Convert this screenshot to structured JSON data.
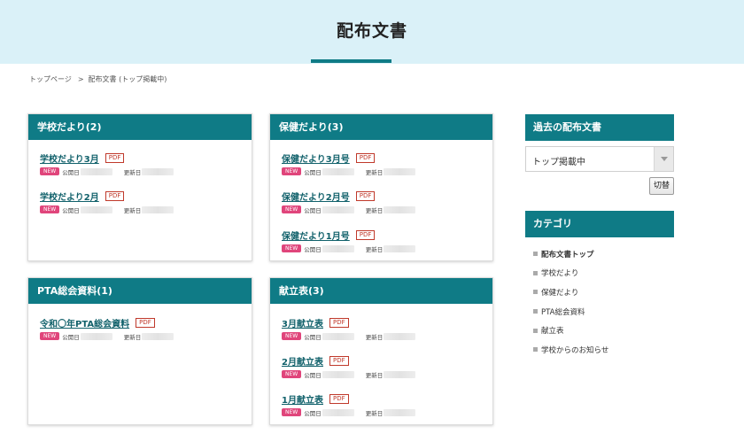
{
  "header": {
    "title": "配布文書"
  },
  "breadcrumb": {
    "home": "トップページ",
    "separator": ">",
    "current": "配布文書 (トップ掲載中)"
  },
  "labels": {
    "pdf": "PDF",
    "new": "NEW",
    "published": "公開日",
    "updated": "更新日"
  },
  "cards": {
    "school": {
      "title": "学校だより(2)",
      "items": [
        {
          "label": "学校だより3月"
        },
        {
          "label": "学校だより2月"
        }
      ]
    },
    "health": {
      "title": "保健だより(3)",
      "items": [
        {
          "label": "保健だより3月号"
        },
        {
          "label": "保健だより2月号"
        },
        {
          "label": "保健だより1月号"
        }
      ]
    },
    "pta": {
      "title": "PTA総会資料(1)",
      "items": [
        {
          "label": "令和〇年PTA総会資料"
        }
      ]
    },
    "menu": {
      "title": "献立表(3)",
      "items": [
        {
          "label": "3月献立表"
        },
        {
          "label": "2月献立表"
        },
        {
          "label": "1月献立表"
        }
      ]
    }
  },
  "sidebar": {
    "past_title": "過去の配布文書",
    "select_value": "トップ掲載中",
    "switch_label": "切替",
    "category_title": "カテゴリ",
    "categories": [
      {
        "label": "配布文書トップ"
      },
      {
        "label": "学校だより"
      },
      {
        "label": "保健だより"
      },
      {
        "label": "PTA総会資料"
      },
      {
        "label": "献立表"
      },
      {
        "label": "学校からのお知らせ"
      }
    ]
  },
  "colors": {
    "teal": "#0f7b86",
    "header_bg": "#daf1f8",
    "new_badge": "#e0457b",
    "pdf_red": "#c0392b"
  }
}
